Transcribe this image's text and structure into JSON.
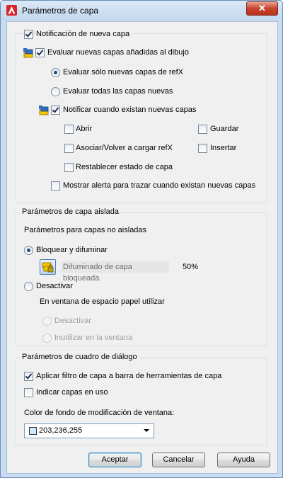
{
  "window": {
    "title": "Parámetros de capa",
    "close_glyph": "✕",
    "app_icon": "autocad-icon"
  },
  "new_layer_notification": {
    "group_label": "Notificación de nueva capa",
    "group_checked": true,
    "evaluate_added": {
      "label": "Evaluar nuevas capas añadidas al dibujo",
      "checked": true
    },
    "radio_xref_only": {
      "label": "Evaluar sólo nuevas capas de refX",
      "selected": true
    },
    "radio_all_new": {
      "label": "Evaluar todas las capas nuevas",
      "selected": false
    },
    "notify_when_exist": {
      "label": "Notificar cuando existan nuevas capas",
      "checked": true
    },
    "open": {
      "label": "Abrir",
      "checked": false
    },
    "save": {
      "label": "Guardar",
      "checked": false
    },
    "attach_reload": {
      "label": "Asociar/Volver a cargar refX",
      "checked": false
    },
    "insert": {
      "label": "Insertar",
      "checked": false
    },
    "restore_state": {
      "label": "Restablecer estado de capa",
      "checked": false
    },
    "plot_alert": {
      "label": "Mostrar alerta para trazar cuando existan nuevas capas",
      "checked": false
    }
  },
  "isolate_settings": {
    "group_label": "Parámetros de capa aislada",
    "subtitle": "Parámetros para capas no aisladas",
    "lock_and_fade": {
      "label": "Bloquear y difuminar",
      "selected": true
    },
    "fade_label": "Difuminado de capa bloqueada",
    "fade_value": "50%",
    "off": {
      "label": "Desactivar",
      "selected": false
    },
    "paper_space_label": "En ventana de espacio papel utilizar",
    "vp_off": {
      "label": "Desactivar",
      "selected": false,
      "disabled": true
    },
    "vp_freeze": {
      "label": "Inutilizar en la ventana",
      "selected": false,
      "disabled": true
    }
  },
  "dialog_settings": {
    "group_label": "Parámetros de cuadro de diálogo",
    "apply_filter": {
      "label": "Aplicar filtro de capa a barra de herramientas de capa",
      "checked": true
    },
    "indicate_in_use": {
      "label": "Indicar capas en uso",
      "checked": false
    },
    "bg_color_label": "Color de fondo de modificación de ventana:",
    "bg_color_value": "203,236,255",
    "bg_color_hex": "#cbecff"
  },
  "buttons": {
    "ok": "Aceptar",
    "cancel": "Cancelar",
    "help": "Ayuda"
  }
}
